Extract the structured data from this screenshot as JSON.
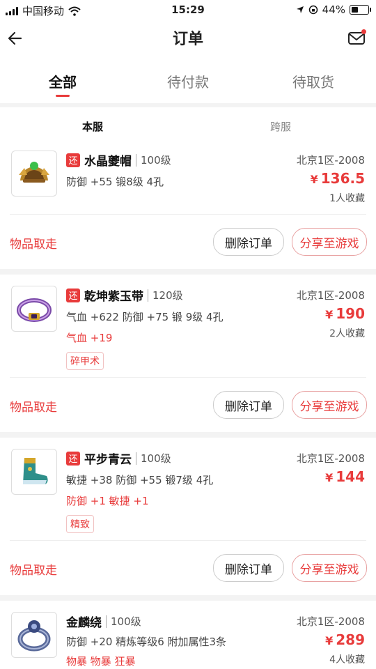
{
  "status": {
    "carrier": "中国移动",
    "time": "15:29",
    "battery": "44%"
  },
  "nav": {
    "title": "订单",
    "back_icon": "back-arrow-icon",
    "mail_icon": "mail-icon"
  },
  "tabs": [
    {
      "label": "全部",
      "active": true
    },
    {
      "label": "待付款",
      "active": false
    },
    {
      "label": "待取货",
      "active": false
    }
  ],
  "sub_tabs": [
    "本服",
    "跨服"
  ],
  "orders": [
    {
      "badge": "还",
      "name": "水晶夔帽",
      "level": "100级",
      "stats": "防御 +55  锻8级  4孔",
      "server": "北京1区-2008",
      "currency": "¥",
      "price": "136.5",
      "fav": "1人收藏",
      "action": "物品取走",
      "btn_delete": "删除订单",
      "btn_share": "分享至游戏"
    },
    {
      "badge": "还",
      "name": "乾坤紫玉带",
      "level": "120级",
      "stats": "气血 +622  防御 +75  锻 9级  4孔",
      "extra": "气血 +19",
      "chip": "碎甲术",
      "server": "北京1区-2008",
      "currency": "¥",
      "price": "190",
      "fav": "2人收藏",
      "action": "物品取走",
      "btn_delete": "删除订单",
      "btn_share": "分享至游戏"
    },
    {
      "badge": "还",
      "name": "平步青云",
      "level": "100级",
      "stats": "敏捷 +38  防御 +55  锻7级  4孔",
      "extra": "防御 +1  敏捷 +1",
      "chip": "精致",
      "server": "北京1区-2008",
      "currency": "¥",
      "price": "144",
      "action": "物品取走",
      "btn_delete": "删除订单",
      "btn_share": "分享至游戏"
    },
    {
      "name": "金麟绕",
      "level": "100级",
      "stats": "防御 +20  精炼等级6  附加属性3条",
      "extra": "物暴  物暴  狂暴",
      "server": "北京1区-2008",
      "currency": "¥",
      "price": "289",
      "fav": "4人收藏"
    }
  ],
  "colors": {
    "accent": "#e83b3b",
    "background": "#f3f3f3"
  }
}
